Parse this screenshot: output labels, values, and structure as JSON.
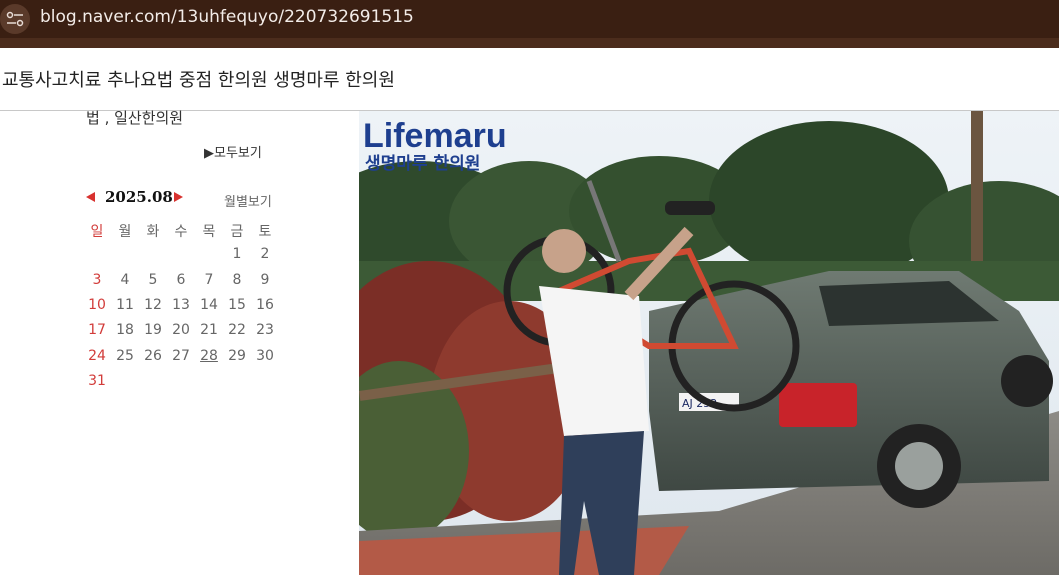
{
  "browser": {
    "url": "blog.naver.com/13uhfequyo/220732691515"
  },
  "post": {
    "title": "교통사고치료 추나요법 중점 한의원 생명마루 한의원"
  },
  "sidebar": {
    "category_text": "법 , 일산한의원",
    "view_all": "▶모두보기"
  },
  "calendar": {
    "month": "2025.08",
    "monthly_view": "월별보기",
    "weekdays": [
      "일",
      "월",
      "화",
      "수",
      "목",
      "금",
      "토"
    ],
    "weeks": [
      [
        "",
        "",
        "",
        "",
        "",
        "1",
        "2"
      ],
      [
        "3",
        "4",
        "5",
        "6",
        "7",
        "8",
        "9"
      ],
      [
        "10",
        "11",
        "12",
        "13",
        "14",
        "15",
        "16"
      ],
      [
        "17",
        "18",
        "19",
        "20",
        "21",
        "22",
        "23"
      ],
      [
        "24",
        "25",
        "26",
        "27",
        "28",
        "29",
        "30"
      ],
      [
        "31",
        "",
        "",
        "",
        "",
        "",
        ""
      ]
    ],
    "underlined_day": "28"
  },
  "photo": {
    "logo_en": "Lifemaru",
    "logo_ko": "생명마루 한의원",
    "plate": "AJ 252 ..."
  },
  "colors": {
    "urlbar": "#3a1f12",
    "accent_red": "#d8322f"
  }
}
